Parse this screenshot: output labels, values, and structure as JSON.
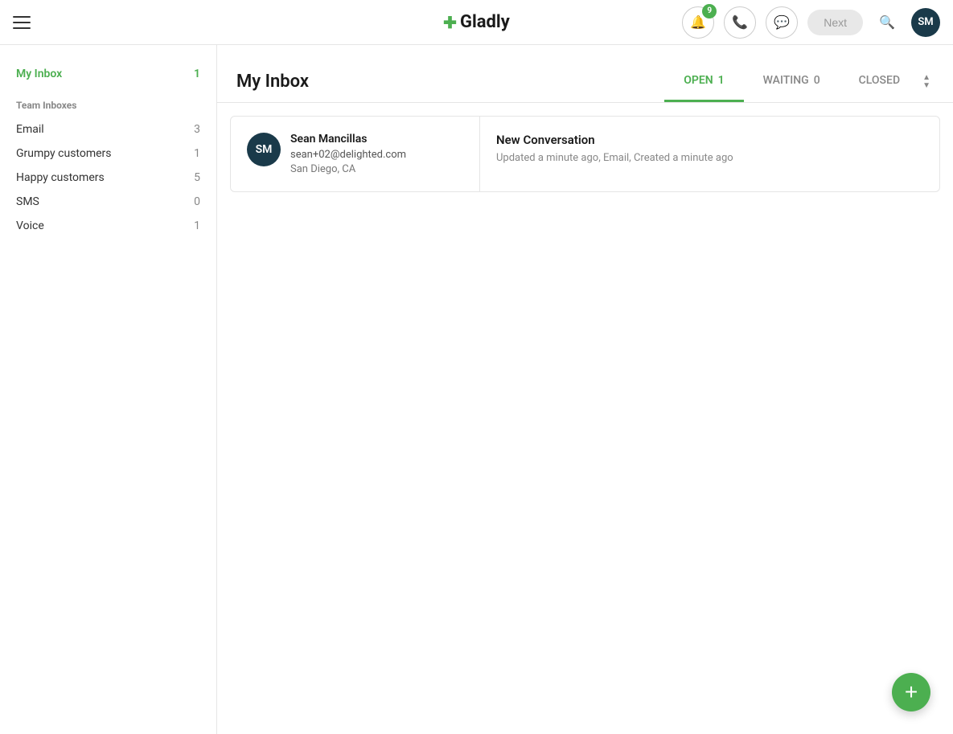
{
  "header": {
    "hamburger_label": "menu",
    "logo_text": "Gladly",
    "logo_icon": "✚",
    "notification_count": "9",
    "next_button_label": "Next",
    "user_initials": "SM"
  },
  "sidebar": {
    "my_inbox_label": "My Inbox",
    "my_inbox_count": "1",
    "team_inboxes_label": "Team Inboxes",
    "items": [
      {
        "label": "Email",
        "count": "3"
      },
      {
        "label": "Grumpy customers",
        "count": "1"
      },
      {
        "label": "Happy customers",
        "count": "5"
      },
      {
        "label": "SMS",
        "count": "0"
      },
      {
        "label": "Voice",
        "count": "1"
      }
    ]
  },
  "main": {
    "title": "My Inbox",
    "tabs": [
      {
        "label": "OPEN",
        "count": "1",
        "active": true
      },
      {
        "label": "WAITING",
        "count": "0",
        "active": false
      },
      {
        "label": "CLOSED",
        "count": "",
        "active": false
      }
    ]
  },
  "conversations": [
    {
      "avatar_initials": "SM",
      "name": "Sean Mancillas",
      "email": "sean+02@delighted.com",
      "location": "San Diego, CA",
      "subject": "New Conversation",
      "meta": "Updated a minute ago, Email, Created a minute ago"
    }
  ],
  "fab": {
    "icon": "+"
  }
}
